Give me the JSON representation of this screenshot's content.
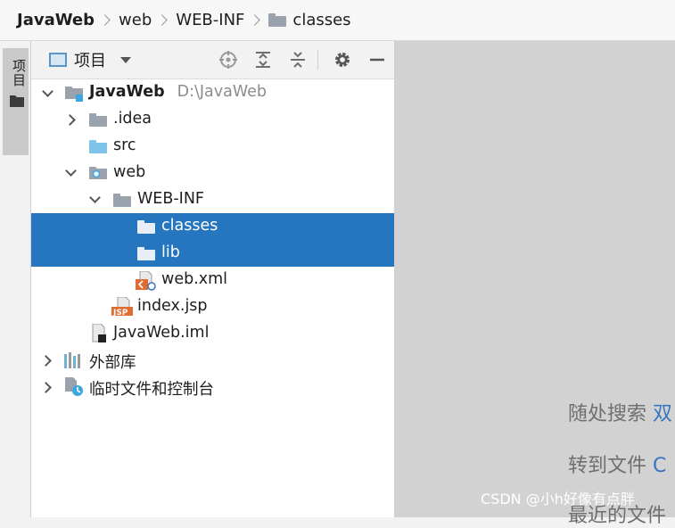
{
  "breadcrumb": {
    "items": [
      "JavaWeb",
      "web",
      "WEB-INF",
      "classes"
    ]
  },
  "sidebar": {
    "tab_label": "项目"
  },
  "project_panel": {
    "title": "项目"
  },
  "tree": {
    "root": {
      "name": "JavaWeb",
      "path": "D:\\JavaWeb"
    },
    "idea": ".idea",
    "src": "src",
    "web": "web",
    "webinf": "WEB-INF",
    "classes": "classes",
    "lib": "lib",
    "webxml": "web.xml",
    "indexjsp": "index.jsp",
    "iml": "JavaWeb.iml",
    "external": "外部库",
    "scratches": "临时文件和控制台"
  },
  "editor": {
    "hint_search": "随处搜索",
    "hint_search_key": "双",
    "hint_goto": "转到文件",
    "hint_goto_key": "C",
    "hint_recent": "最近的文件",
    "watermark": "CSDN @小h好像有点胖"
  },
  "colors": {
    "selection": "#2675bf",
    "folder": "#9aa3ad",
    "link": "#3a74c0"
  }
}
